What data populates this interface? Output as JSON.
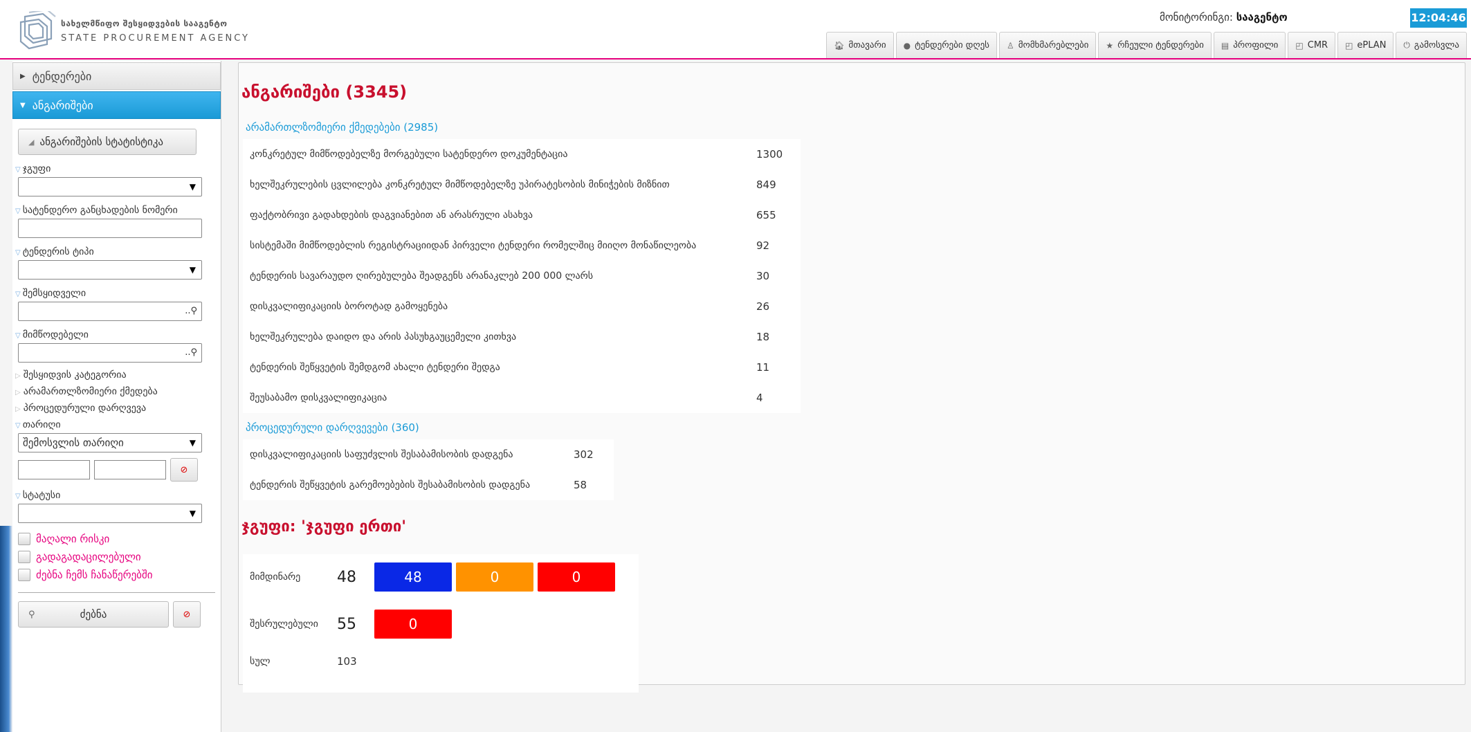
{
  "header": {
    "agency_name_ge": "სახელმწიფო შესყიდვების სააგენტო",
    "agency_name_en": "STATE PROCUREMENT AGENCY",
    "monitor_label": "მონიტორინგი:",
    "monitor_user": "სააგენტო",
    "clock": "12:04:46",
    "nav": [
      {
        "label": "მთავარი",
        "icon": "home-icon"
      },
      {
        "label": "ტენდერები დღეს",
        "icon": "dot-icon"
      },
      {
        "label": "მომხმარებლები",
        "icon": "user-icon"
      },
      {
        "label": "რჩეული ტენდერები",
        "icon": "star-icon"
      },
      {
        "label": "პროფილი",
        "icon": "card-icon"
      },
      {
        "label": "CMR",
        "icon": "external-link-icon"
      },
      {
        "label": "ePLAN",
        "icon": "external-link-icon"
      },
      {
        "label": "გამოსვლა",
        "icon": "power-icon"
      }
    ]
  },
  "sidebar": {
    "acc_tenders": "ტენდერები",
    "acc_reports": "ანგარიშები",
    "stats_button": "ანგარიშების სტატისტიკა",
    "group_label": "ჯგუფი",
    "announce_label": "სატენდერო განცხადების ნომერი",
    "tender_type_label": "ტენდერის ტიპი",
    "buyer_label": "შემსყიდველი",
    "supplier_label": "მიმწოდებელი",
    "category_label": "შესყიდვის კატეგორია",
    "illegal_label": "არამართლზომიერი ქმედება",
    "procedural_label": "პროცედურული დარღვევა",
    "date_label": "თარიღი",
    "date_type_value": "შემოსვლის თარიღი",
    "status_label": "სტატუსი",
    "high_risk": "მაღალი რისკი",
    "forwarded": "გადაგადაცილებული",
    "search_records": "ძებნა ჩემს ჩანაწერებში",
    "search_button": "ძებნა"
  },
  "main": {
    "title": "ანგარიშები (3345)",
    "section1_title": "არამართლზომიერი ქმედებები (2985)",
    "section1_rows": [
      {
        "label": "კონკრეტულ მიმწოდებელზე მორგებული სატენდერო დოკუმენტაცია",
        "value": "1300"
      },
      {
        "label": "ხელშეკრულების ცვლილება კონკრეტულ მიმწოდებელზე უპირატესობის მინიჭების მიზნით",
        "value": "849"
      },
      {
        "label": "ფაქტობრივი გადახდების დაგვიანებით ან არასრული ასახვა",
        "value": "655"
      },
      {
        "label": "სისტემაში მიმწოდებლის რეგისტრაციიდან პირველი ტენდერი რომელშიც მიიღო მონაწილეობა",
        "value": "92"
      },
      {
        "label": "ტენდერის სავარაუდო ღირებულება შეადგენს არანაკლებ 200 000 ლარს",
        "value": "30"
      },
      {
        "label": "დისკვალიფიკაციის ბოროტად გამოყენება",
        "value": "26"
      },
      {
        "label": "ხელშეკრულება დაიდო და არის პასუხგაუცემელი კითხვა",
        "value": "18"
      },
      {
        "label": "ტენდერის შეწყვეტის შემდგომ ახალი ტენდერი შედგა",
        "value": "11"
      },
      {
        "label": "შეუსაბამო დისკვალიფიკაცია",
        "value": "4"
      }
    ],
    "section2_title": "პროცედურული დარღვევები (360)",
    "section2_rows": [
      {
        "label": "დისკვალიფიკაციის საფუძვლის შესაბამისობის დადგენა",
        "value": "302"
      },
      {
        "label": "ტენდერის შეწყვეტის გარემოებების შესაბამისობის დადგენა",
        "value": "58"
      }
    ],
    "group_title": "ჯგუფი: 'ჯგუფი ერთი'",
    "group": {
      "current_label": "მიმდინარე",
      "current_count": "48",
      "current_boxes": [
        {
          "value": "48",
          "color": "#0a28e6"
        },
        {
          "value": "0",
          "color": "#ff9200"
        },
        {
          "value": "0",
          "color": "#ff0000"
        }
      ],
      "done_label": "შესრულებული",
      "done_count": "55",
      "done_boxes": [
        {
          "value": "0",
          "color": "#ff0000"
        }
      ],
      "total_label": "სულ",
      "total_count": "103"
    }
  }
}
